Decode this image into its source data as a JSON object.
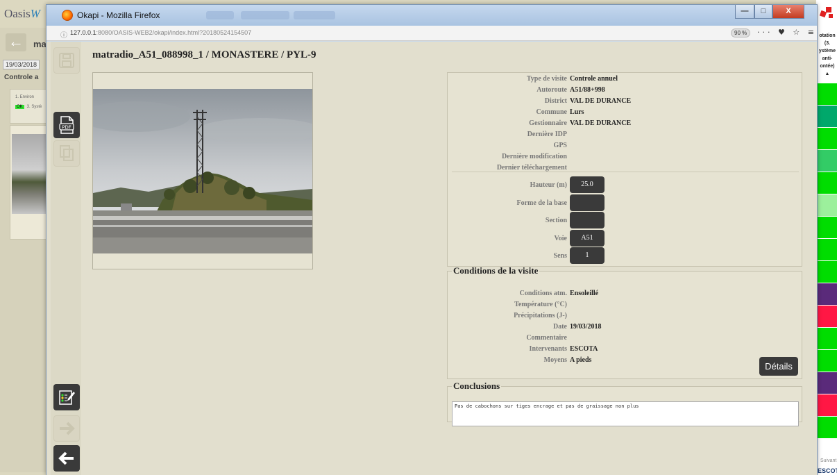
{
  "background_app": {
    "logo_text": "Oasis",
    "logo_suffix": "W",
    "partial_title": "ma",
    "date": "19/03/2018",
    "controle": "Controle a",
    "env_item": "1. Environ",
    "ok_badge": "OK",
    "system_item": "3. Systè",
    "right_text": [
      "otation",
      "(3.",
      "ystème",
      "anti-",
      "ontée)",
      "▲"
    ],
    "suivant": "Suivant",
    "escota": "ESCOTA",
    "right_strip_colors": [
      "#00dd00",
      "#00a86b",
      "#00dd00",
      "#33cc66",
      "#00dd00",
      "#9cf09c",
      "#00dd00",
      "#00dd00",
      "#00dd00",
      "#5a2a7a",
      "#ff1744",
      "#00dd00",
      "#00dd00",
      "#5a2a7a",
      "#ff1744",
      "#00dd00"
    ]
  },
  "browser": {
    "tab_title": "Okapi - Mozilla Firefox",
    "url_host": "127.0.0.1",
    "url_rest": ":8080/OASIS-WEB2/okapi/index.html?20180524154507",
    "zoom": "90 %",
    "toolbar_icons": "··· ♥ ☆ ≡",
    "min_glyph": "—",
    "max_glyph": "□",
    "close_glyph": "X"
  },
  "page": {
    "title": "matradio_A51_088998_1 / MONASTERE / PYL-9"
  },
  "info": {
    "fields": [
      {
        "label": "Type de visite",
        "value": "Controle annuel"
      },
      {
        "label": "Autoroute",
        "value": "A51/88+998"
      },
      {
        "label": "District",
        "value": "VAL DE DURANCE"
      },
      {
        "label": "Commune",
        "value": "Lurs"
      },
      {
        "label": "Gestionnaire",
        "value": "VAL DE DURANCE"
      },
      {
        "label": "Dernière IDP",
        "value": ""
      },
      {
        "label": "GPS",
        "value": ""
      },
      {
        "label": "Dernière modification",
        "value": ""
      },
      {
        "label": "Dernier téléchargement",
        "value": ""
      }
    ],
    "details": [
      {
        "label": "Hauteur (m)",
        "value": "25.0"
      },
      {
        "label": "Forme de la base",
        "value": ""
      },
      {
        "label": "Section",
        "value": ""
      },
      {
        "label": "Voie",
        "value": "A51"
      },
      {
        "label": "Sens",
        "value": "1"
      }
    ]
  },
  "conditions": {
    "legend": "Conditions de la visite",
    "fields": [
      {
        "label": "Conditions atm.",
        "value": "Ensoleillé"
      },
      {
        "label": "Température (°C)",
        "value": ""
      },
      {
        "label": "Précipitations (J-)",
        "value": ""
      },
      {
        "label": "Date",
        "value": "19/03/2018"
      },
      {
        "label": "Commentaire",
        "value": ""
      },
      {
        "label": "Intervenants",
        "value": "ESCOTA"
      },
      {
        "label": "Moyens",
        "value": "A pieds"
      }
    ],
    "details_button": "Détails"
  },
  "conclusions": {
    "legend": "Conclusions",
    "text": "Pas de cabochons sur tiges encrage  et pas de graissage non plus"
  },
  "sidebar": {
    "pdf_label": "PDF"
  }
}
